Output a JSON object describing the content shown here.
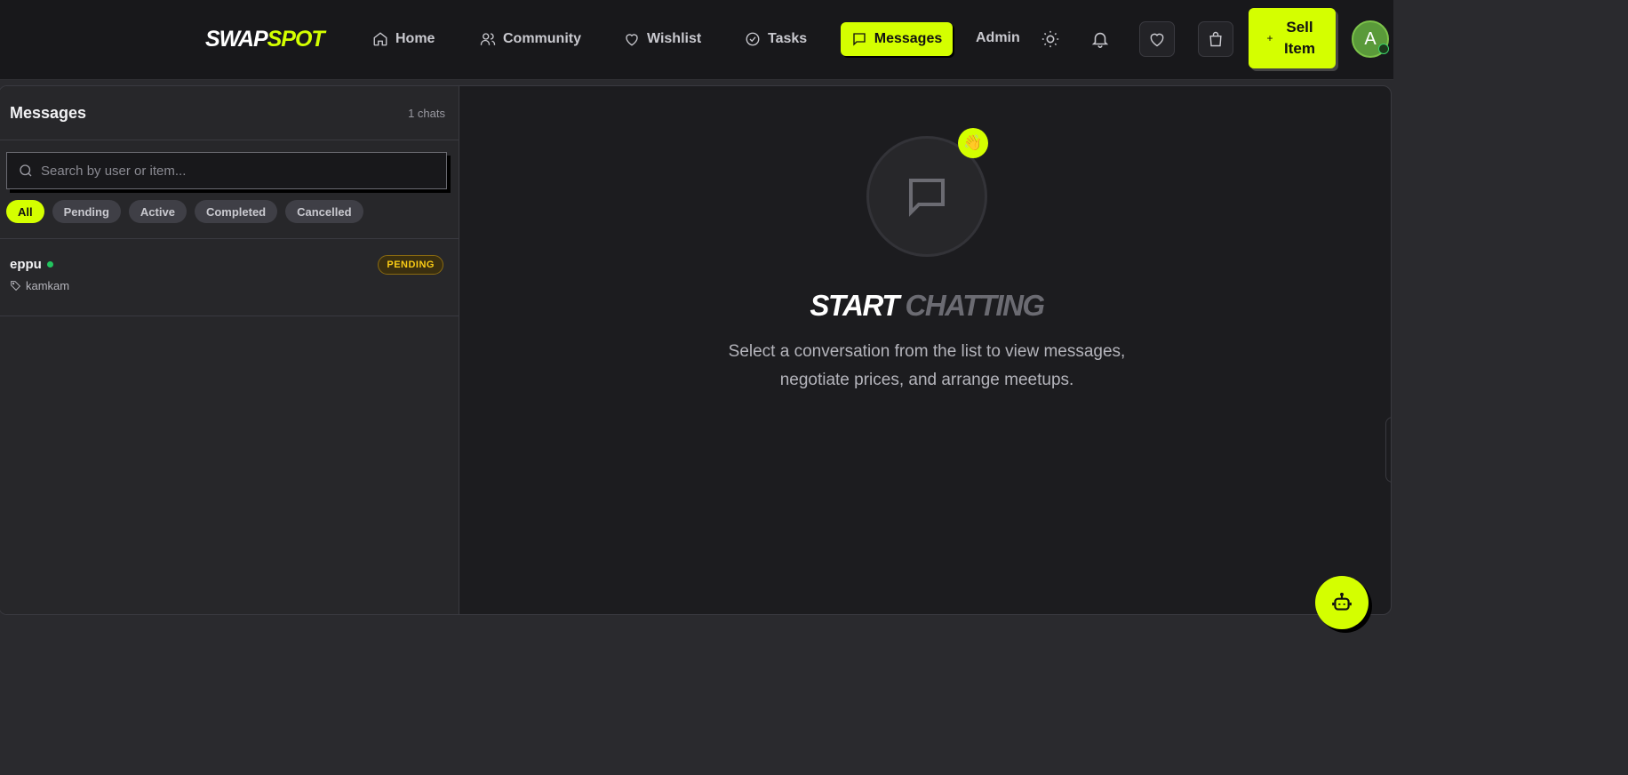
{
  "nav": {
    "logo_part1": "SWAP",
    "logo_part2": "SPOT",
    "links": [
      {
        "label": "Home",
        "icon": "home-icon"
      },
      {
        "label": "Community",
        "icon": "users-icon"
      },
      {
        "label": "Wishlist",
        "icon": "heart-icon"
      },
      {
        "label": "Tasks",
        "icon": "check-circle-icon"
      },
      {
        "label": "Messages",
        "icon": "message-square-icon",
        "active": true
      },
      {
        "label": "Admin"
      }
    ],
    "sell_label": "Sell Item",
    "avatar_initial": "A",
    "accent": "#d4ff00"
  },
  "sidebar": {
    "title": "Messages",
    "count": "1 chats",
    "search_placeholder": "Search by user or item...",
    "filters": [
      "All",
      "Pending",
      "Active",
      "Completed",
      "Cancelled"
    ],
    "active_filter": "All",
    "chats": [
      {
        "user": "eppu",
        "online": true,
        "item": "kamkam",
        "status": "PENDING"
      }
    ]
  },
  "empty_state": {
    "title_part1": "START",
    "title_part2": "CHATTING",
    "emoji": "👋",
    "description": "Select a conversation from the list to view messages, negotiate prices, and arrange meetups."
  }
}
